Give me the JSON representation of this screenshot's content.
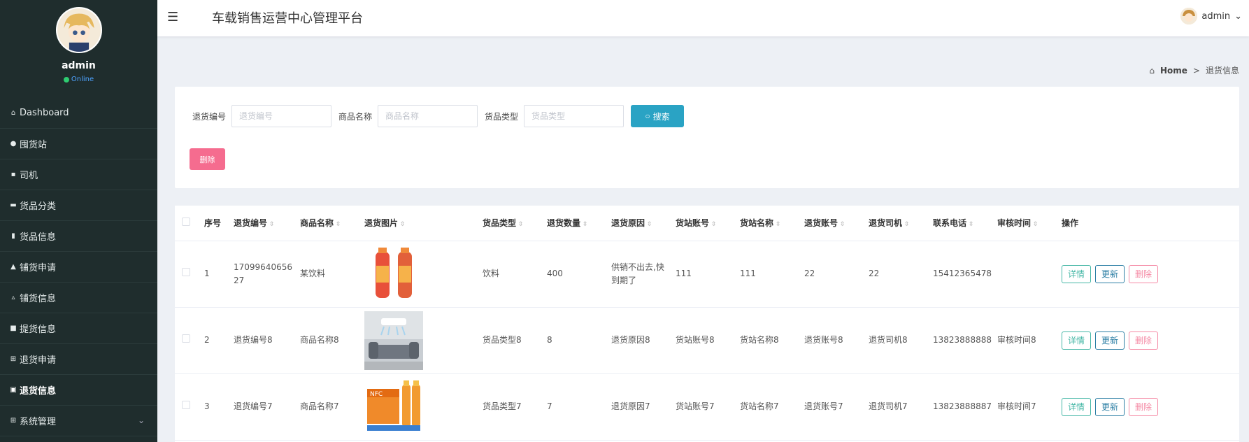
{
  "sidebar": {
    "user": "admin",
    "status": "Online",
    "items": [
      {
        "label": "Dashboard",
        "icon": "home-icon"
      },
      {
        "label": "囤货站",
        "icon": "map-pin-icon"
      },
      {
        "label": "司机",
        "icon": "chat-icon"
      },
      {
        "label": "货品分类",
        "icon": "folder-icon"
      },
      {
        "label": "货品信息",
        "icon": "chart-icon"
      },
      {
        "label": "铺货申请",
        "icon": "user-icon"
      },
      {
        "label": "铺货信息",
        "icon": "user-icon"
      },
      {
        "label": "提货信息",
        "icon": "doc-icon"
      },
      {
        "label": "退货申请",
        "icon": "grid-icon"
      },
      {
        "label": "退货信息",
        "icon": "clipboard-icon"
      },
      {
        "label": "系统管理",
        "icon": "grid-icon"
      }
    ]
  },
  "header": {
    "title": "车载销售运营中心管理平台",
    "user": "admin"
  },
  "breadcrumb": {
    "home": "Home",
    "separator": ">",
    "current": "退货信息"
  },
  "search": {
    "fields": [
      {
        "label": "退货编号",
        "placeholder": "退货编号"
      },
      {
        "label": "商品名称",
        "placeholder": "商品名称"
      },
      {
        "label": "货品类型",
        "placeholder": "货品类型"
      }
    ],
    "button": "搜索",
    "delete_button": "删除"
  },
  "table": {
    "columns": [
      "序号",
      "退货编号",
      "商品名称",
      "退货图片",
      "货品类型",
      "退货数量",
      "退货原因",
      "货站账号",
      "货站名称",
      "退货账号",
      "退货司机",
      "联系电话",
      "审核时间",
      "操作"
    ],
    "actions": {
      "detail": "详情",
      "update": "更新",
      "delete": "删除"
    },
    "rows": [
      {
        "index": "1",
        "code": "1709964065627",
        "name": "某饮料",
        "type": "饮料",
        "qty": "400",
        "reason": "供销不出去,快到期了",
        "station_acc": "111",
        "station_name": "111",
        "return_acc": "22",
        "driver": "22",
        "phone": "15412365478",
        "audit_time": ""
      },
      {
        "index": "2",
        "code": "退货编号8",
        "name": "商品名称8",
        "type": "货品类型8",
        "qty": "8",
        "reason": "退货原因8",
        "station_acc": "货站账号8",
        "station_name": "货站名称8",
        "return_acc": "退货账号8",
        "driver": "退货司机8",
        "phone": "13823888888",
        "audit_time": "审核时间8"
      },
      {
        "index": "3",
        "code": "退货编号7",
        "name": "商品名称7",
        "type": "货品类型7",
        "qty": "7",
        "reason": "退货原因7",
        "station_acc": "货站账号7",
        "station_name": "货站名称7",
        "return_acc": "退货账号7",
        "driver": "退货司机7",
        "phone": "13823888887",
        "audit_time": "审核时间7"
      }
    ]
  }
}
